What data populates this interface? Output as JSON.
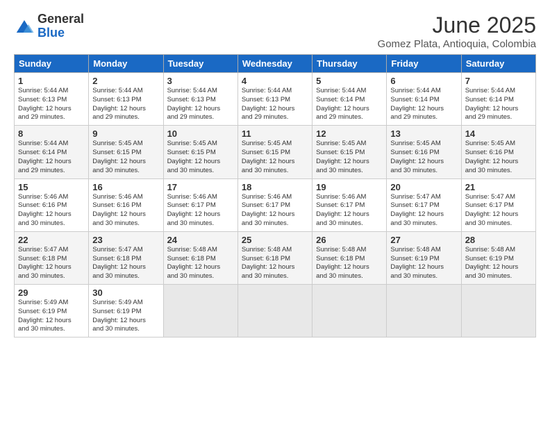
{
  "logo": {
    "general": "General",
    "blue": "Blue"
  },
  "title": "June 2025",
  "subtitle": "Gomez Plata, Antioquia, Colombia",
  "days_header": [
    "Sunday",
    "Monday",
    "Tuesday",
    "Wednesday",
    "Thursday",
    "Friday",
    "Saturday"
  ],
  "weeks": [
    [
      {
        "num": "1",
        "rise": "5:44 AM",
        "set": "6:13 PM",
        "daylight": "12 hours and 29 minutes."
      },
      {
        "num": "2",
        "rise": "5:44 AM",
        "set": "6:13 PM",
        "daylight": "12 hours and 29 minutes."
      },
      {
        "num": "3",
        "rise": "5:44 AM",
        "set": "6:13 PM",
        "daylight": "12 hours and 29 minutes."
      },
      {
        "num": "4",
        "rise": "5:44 AM",
        "set": "6:13 PM",
        "daylight": "12 hours and 29 minutes."
      },
      {
        "num": "5",
        "rise": "5:44 AM",
        "set": "6:14 PM",
        "daylight": "12 hours and 29 minutes."
      },
      {
        "num": "6",
        "rise": "5:44 AM",
        "set": "6:14 PM",
        "daylight": "12 hours and 29 minutes."
      },
      {
        "num": "7",
        "rise": "5:44 AM",
        "set": "6:14 PM",
        "daylight": "12 hours and 29 minutes."
      }
    ],
    [
      {
        "num": "8",
        "rise": "5:44 AM",
        "set": "6:14 PM",
        "daylight": "12 hours and 29 minutes."
      },
      {
        "num": "9",
        "rise": "5:45 AM",
        "set": "6:15 PM",
        "daylight": "12 hours and 30 minutes."
      },
      {
        "num": "10",
        "rise": "5:45 AM",
        "set": "6:15 PM",
        "daylight": "12 hours and 30 minutes."
      },
      {
        "num": "11",
        "rise": "5:45 AM",
        "set": "6:15 PM",
        "daylight": "12 hours and 30 minutes."
      },
      {
        "num": "12",
        "rise": "5:45 AM",
        "set": "6:15 PM",
        "daylight": "12 hours and 30 minutes."
      },
      {
        "num": "13",
        "rise": "5:45 AM",
        "set": "6:16 PM",
        "daylight": "12 hours and 30 minutes."
      },
      {
        "num": "14",
        "rise": "5:45 AM",
        "set": "6:16 PM",
        "daylight": "12 hours and 30 minutes."
      }
    ],
    [
      {
        "num": "15",
        "rise": "5:46 AM",
        "set": "6:16 PM",
        "daylight": "12 hours and 30 minutes."
      },
      {
        "num": "16",
        "rise": "5:46 AM",
        "set": "6:16 PM",
        "daylight": "12 hours and 30 minutes."
      },
      {
        "num": "17",
        "rise": "5:46 AM",
        "set": "6:17 PM",
        "daylight": "12 hours and 30 minutes."
      },
      {
        "num": "18",
        "rise": "5:46 AM",
        "set": "6:17 PM",
        "daylight": "12 hours and 30 minutes."
      },
      {
        "num": "19",
        "rise": "5:46 AM",
        "set": "6:17 PM",
        "daylight": "12 hours and 30 minutes."
      },
      {
        "num": "20",
        "rise": "5:47 AM",
        "set": "6:17 PM",
        "daylight": "12 hours and 30 minutes."
      },
      {
        "num": "21",
        "rise": "5:47 AM",
        "set": "6:17 PM",
        "daylight": "12 hours and 30 minutes."
      }
    ],
    [
      {
        "num": "22",
        "rise": "5:47 AM",
        "set": "6:18 PM",
        "daylight": "12 hours and 30 minutes."
      },
      {
        "num": "23",
        "rise": "5:47 AM",
        "set": "6:18 PM",
        "daylight": "12 hours and 30 minutes."
      },
      {
        "num": "24",
        "rise": "5:48 AM",
        "set": "6:18 PM",
        "daylight": "12 hours and 30 minutes."
      },
      {
        "num": "25",
        "rise": "5:48 AM",
        "set": "6:18 PM",
        "daylight": "12 hours and 30 minutes."
      },
      {
        "num": "26",
        "rise": "5:48 AM",
        "set": "6:18 PM",
        "daylight": "12 hours and 30 minutes."
      },
      {
        "num": "27",
        "rise": "5:48 AM",
        "set": "6:19 PM",
        "daylight": "12 hours and 30 minutes."
      },
      {
        "num": "28",
        "rise": "5:48 AM",
        "set": "6:19 PM",
        "daylight": "12 hours and 30 minutes."
      }
    ],
    [
      {
        "num": "29",
        "rise": "5:49 AM",
        "set": "6:19 PM",
        "daylight": "12 hours and 30 minutes."
      },
      {
        "num": "30",
        "rise": "5:49 AM",
        "set": "6:19 PM",
        "daylight": "12 hours and 30 minutes."
      },
      null,
      null,
      null,
      null,
      null
    ]
  ]
}
